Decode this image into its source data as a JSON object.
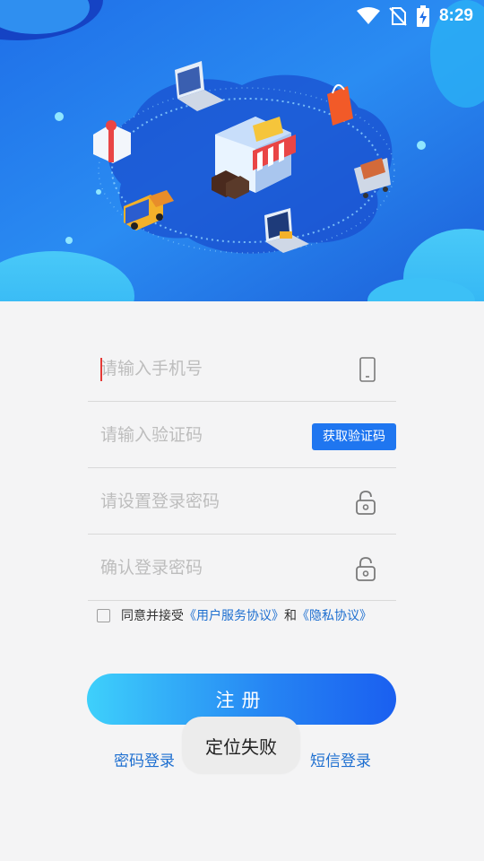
{
  "status_bar": {
    "time": "8:29",
    "icons": [
      "wifi-icon",
      "no-sim-icon",
      "battery-charging-icon"
    ]
  },
  "banner": {
    "illustration": "e-commerce-store-illustration"
  },
  "form": {
    "phone_placeholder": "请输入手机号",
    "code_placeholder": "请输入验证码",
    "get_code_label": "获取验证码",
    "password_placeholder": "请设置登录密码",
    "confirm_placeholder": "确认登录密码"
  },
  "agreement": {
    "prefix": "同意并接受",
    "user_agreement": "《用户服务协议》",
    "and": "和",
    "privacy_policy": "《隐私协议》",
    "checked": false
  },
  "register_label": "注册",
  "password_login_label": "密码登录",
  "sms_login_label": "短信登录",
  "toast_text": "定位失败",
  "colors": {
    "accent": "#1f76f0",
    "link": "#1e6fd0",
    "banner_dark": "#1a4fd8",
    "banner_light": "#38c6f7"
  }
}
